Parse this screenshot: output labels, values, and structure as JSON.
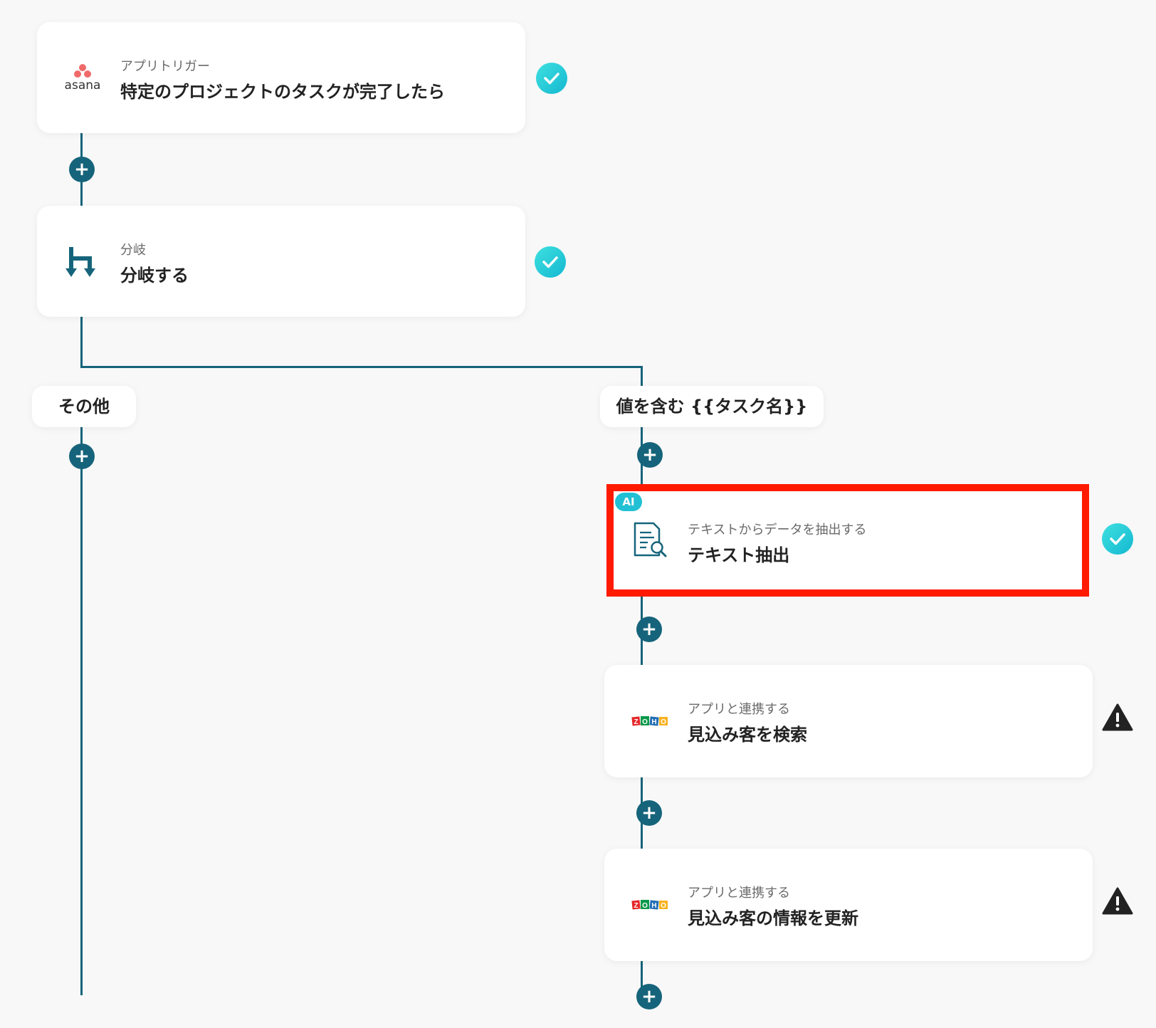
{
  "steps": [
    {
      "sub": "アプリトリガー",
      "title": "特定のプロジェクトのタスクが完了したら",
      "icon": "asana-logo",
      "logo_text": "asana",
      "status": "check"
    },
    {
      "sub": "分岐",
      "title": "分岐する",
      "icon": "branch-icon",
      "status": "check"
    },
    {
      "sub": "テキストからデータを抽出する",
      "title": "テキスト抽出",
      "icon": "document-search-icon",
      "badge": "AI",
      "status": "check",
      "highlighted": true
    },
    {
      "sub": "アプリと連携する",
      "title": "見込み客を検索",
      "icon": "zoho-logo",
      "status": "warning"
    },
    {
      "sub": "アプリと連携する",
      "title": "見込み客の情報を更新",
      "icon": "zoho-logo",
      "status": "warning"
    }
  ],
  "branches": {
    "left_label": "その他",
    "right_label": "値を含む {{タスク名}}"
  },
  "plus_symbol": "+",
  "zoho_letters": [
    "Z",
    "O",
    "H",
    "O"
  ],
  "colors": {
    "line": "#16647b",
    "check": "#22c0d4",
    "highlight": "#ff1a00",
    "asana": "#f06a6a"
  }
}
